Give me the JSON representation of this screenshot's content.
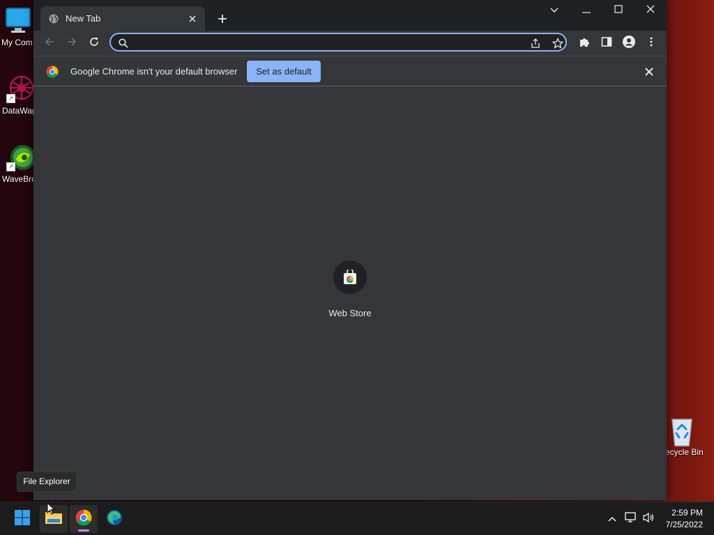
{
  "desktop": {
    "icons": [
      {
        "label": "My Com",
        "icon": "monitor-icon"
      },
      {
        "label": "DataWag",
        "icon": "datawag-icon"
      },
      {
        "label": "WaveBro",
        "icon": "wavebrowser-icon"
      },
      {
        "label": "ecycle Bin",
        "icon": "recycle-bin-icon"
      }
    ]
  },
  "browser": {
    "tab": {
      "title": "New Tab",
      "icon": "globe-icon"
    },
    "omnibox": {
      "value": "",
      "placeholder": ""
    },
    "infobar": {
      "message": "Google Chrome isn't your default browser",
      "button_label": "Set as default"
    },
    "shortcuts": [
      {
        "name": "Web Store",
        "icon": "web-store-icon"
      }
    ],
    "accent": "#8ab4f8"
  },
  "taskbar": {
    "tooltip": "File Explorer",
    "apps": [
      {
        "name": "Start",
        "icon": "windows-start-icon"
      },
      {
        "name": "File Explorer",
        "icon": "folder-icon"
      },
      {
        "name": "Google Chrome",
        "icon": "chrome-icon"
      },
      {
        "name": "Microsoft Edge",
        "icon": "edge-icon"
      }
    ],
    "clock": {
      "time": "2:59 PM",
      "date": "7/25/2022"
    }
  }
}
